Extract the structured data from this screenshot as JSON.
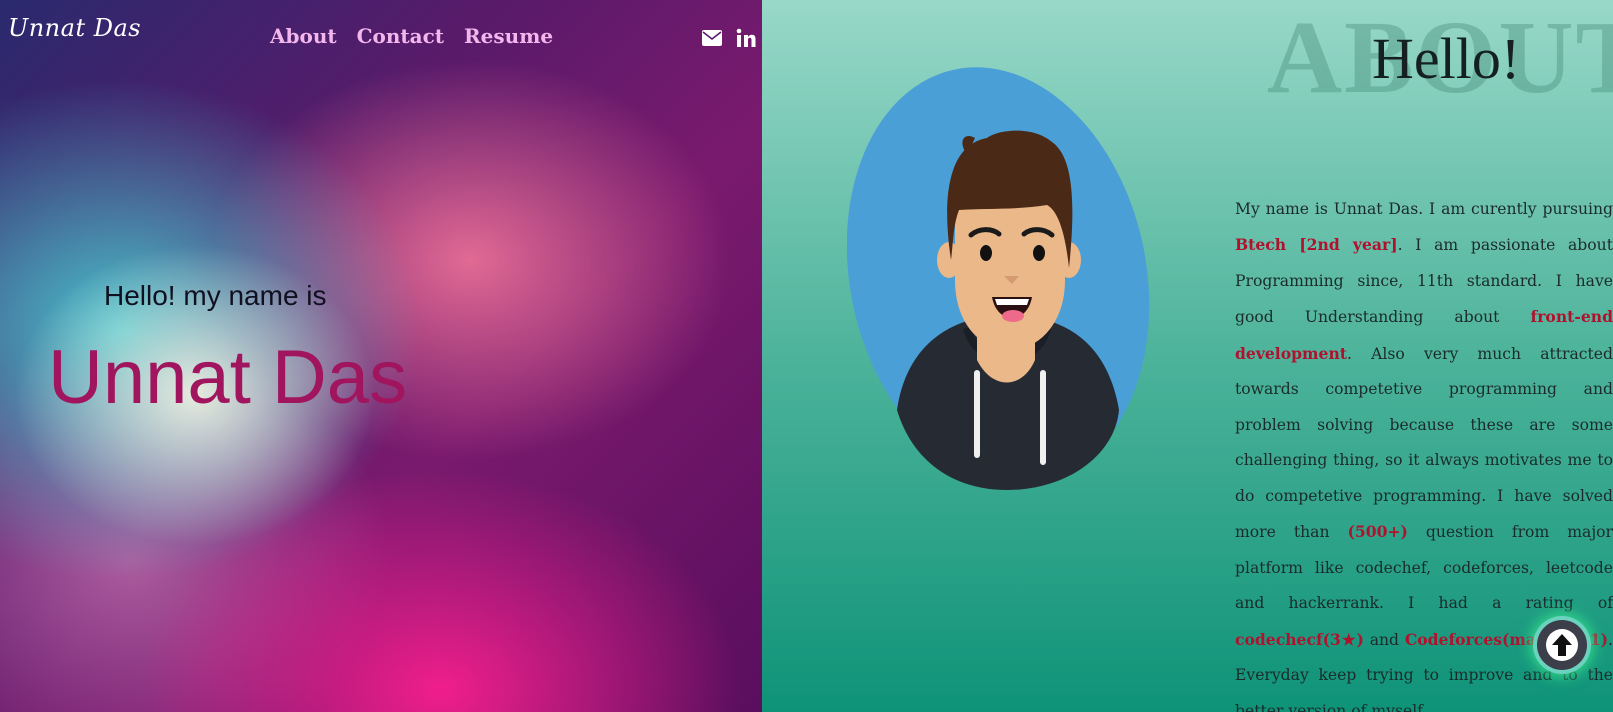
{
  "brand": {
    "logo": "Unnat Das"
  },
  "nav": {
    "items": [
      "About",
      "Contact",
      "Resume"
    ]
  },
  "social": {
    "icons": [
      "envelope-icon",
      "linkedin-icon"
    ]
  },
  "hero": {
    "greeting": "Hello! my name is",
    "name": "Unnat Das"
  },
  "about": {
    "background_word": "ABOUT",
    "heading": "Hello!",
    "paragraph": [
      {
        "text": "My name is Unnat Das. I am curently pursuing ",
        "highlight": false
      },
      {
        "text": "Btech [2nd year]",
        "highlight": true
      },
      {
        "text": ". I am passionate about Programming since, 11th standard. I have good Understanding about ",
        "highlight": false
      },
      {
        "text": "front-end development",
        "highlight": true
      },
      {
        "text": ". Also very much attracted towards competetive programming and problem solving because these are some challenging thing, so it always motivates me to do competetive programming. I have solved more than ",
        "highlight": false
      },
      {
        "text": "(500+)",
        "highlight": true
      },
      {
        "text": " question from major platform like codechef, codeforces, leetcode and hackerrank. I had a rating of ",
        "highlight": false
      },
      {
        "text": "codechecf(3★)",
        "highlight": true
      },
      {
        "text": " and ",
        "highlight": false
      },
      {
        "text": "Codeforces(max: 1061)",
        "highlight": true
      },
      {
        "text": ". Everyday keep trying to improve and to the better version of myself.",
        "highlight": false
      }
    ]
  },
  "colors": {
    "accent": "#a0155e",
    "nav": "#f3b7ee",
    "highlight": "#b0122e"
  }
}
